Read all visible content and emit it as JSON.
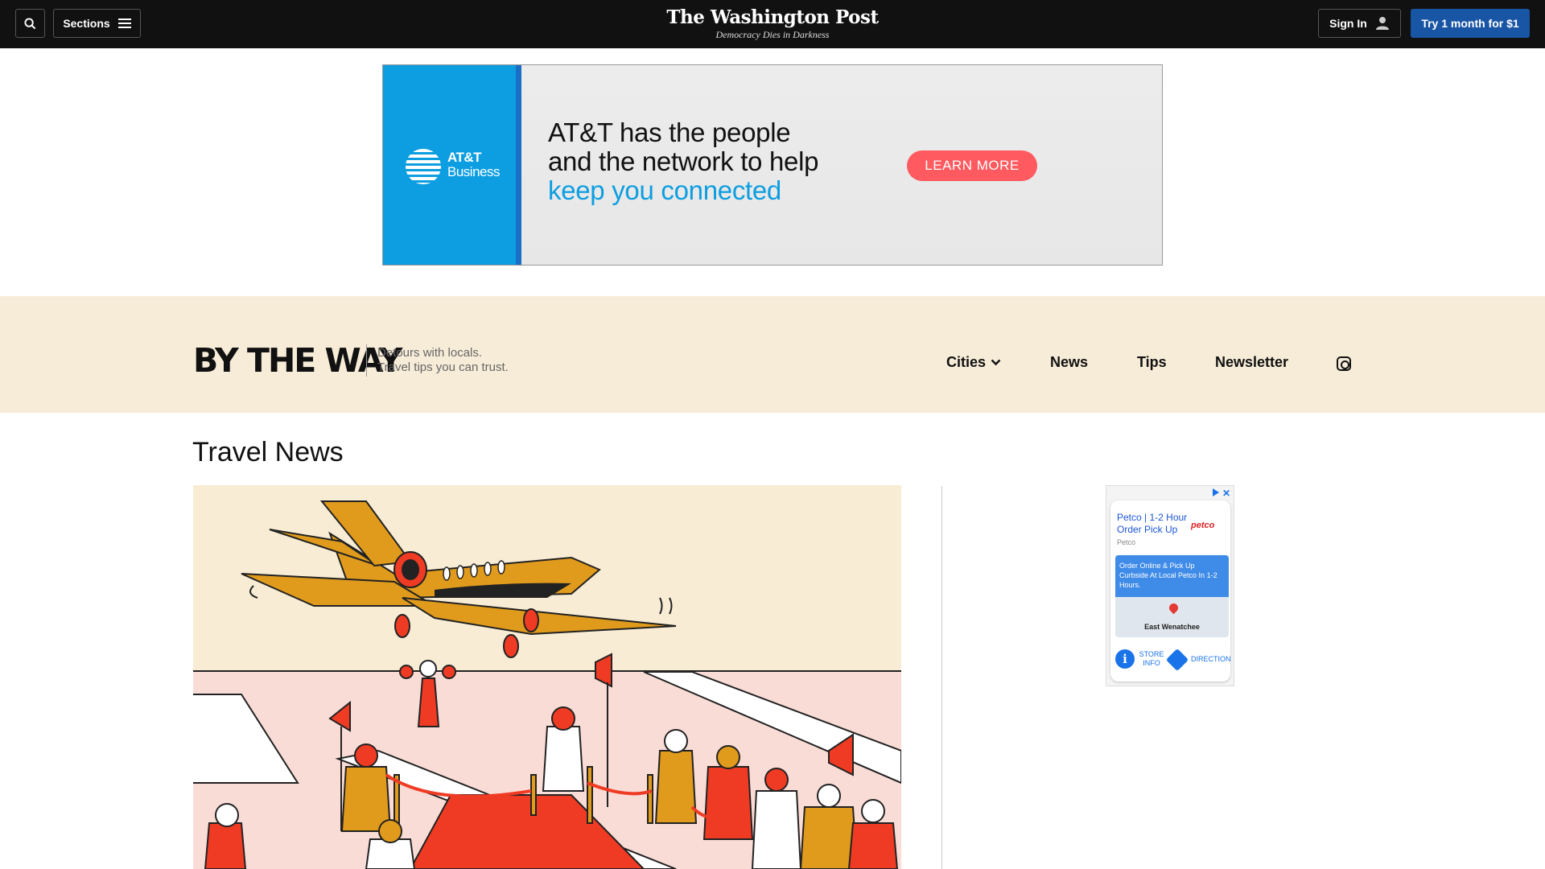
{
  "header": {
    "sections_label": "Sections",
    "logo_name": "The Washington Post",
    "logo_tagline": "Democracy Dies in Darkness",
    "signin_label": "Sign In",
    "subscribe_label": "Try 1 month for $1"
  },
  "top_ad": {
    "brand_line1": "AT&T",
    "brand_line2": "Business",
    "headline_line1": "AT&T has the people",
    "headline_line2": "and the network to help",
    "headline_line3": "keep you connected",
    "cta": "LEARN MORE"
  },
  "by_the_way": {
    "logo_text": "BY THE WAY",
    "tagline_line1": "Detours with locals.",
    "tagline_line2": "Travel tips you can trust.",
    "nav": [
      {
        "label": "Cities"
      },
      {
        "label": "News"
      },
      {
        "label": "Tips"
      },
      {
        "label": "Newsletter"
      }
    ]
  },
  "main": {
    "title": "Travel News"
  },
  "side_ad": {
    "title": "Petco | 1-2 Hour Order Pick Up",
    "brand": "petco",
    "advertiser": "Petco",
    "map_caption": "Order Online & Pick Up Curbside At Local Petco In 1-2 Hours.",
    "map_place": "East Wenatchee",
    "store_info": "STORE INFO",
    "directions": "DIRECTIONS"
  },
  "colors": {
    "topbar": "#111111",
    "subscribe": "#1955a5",
    "att_blue": "#0d9ee1",
    "cta": "#ff5a5f",
    "band": "#f7ecd8"
  }
}
